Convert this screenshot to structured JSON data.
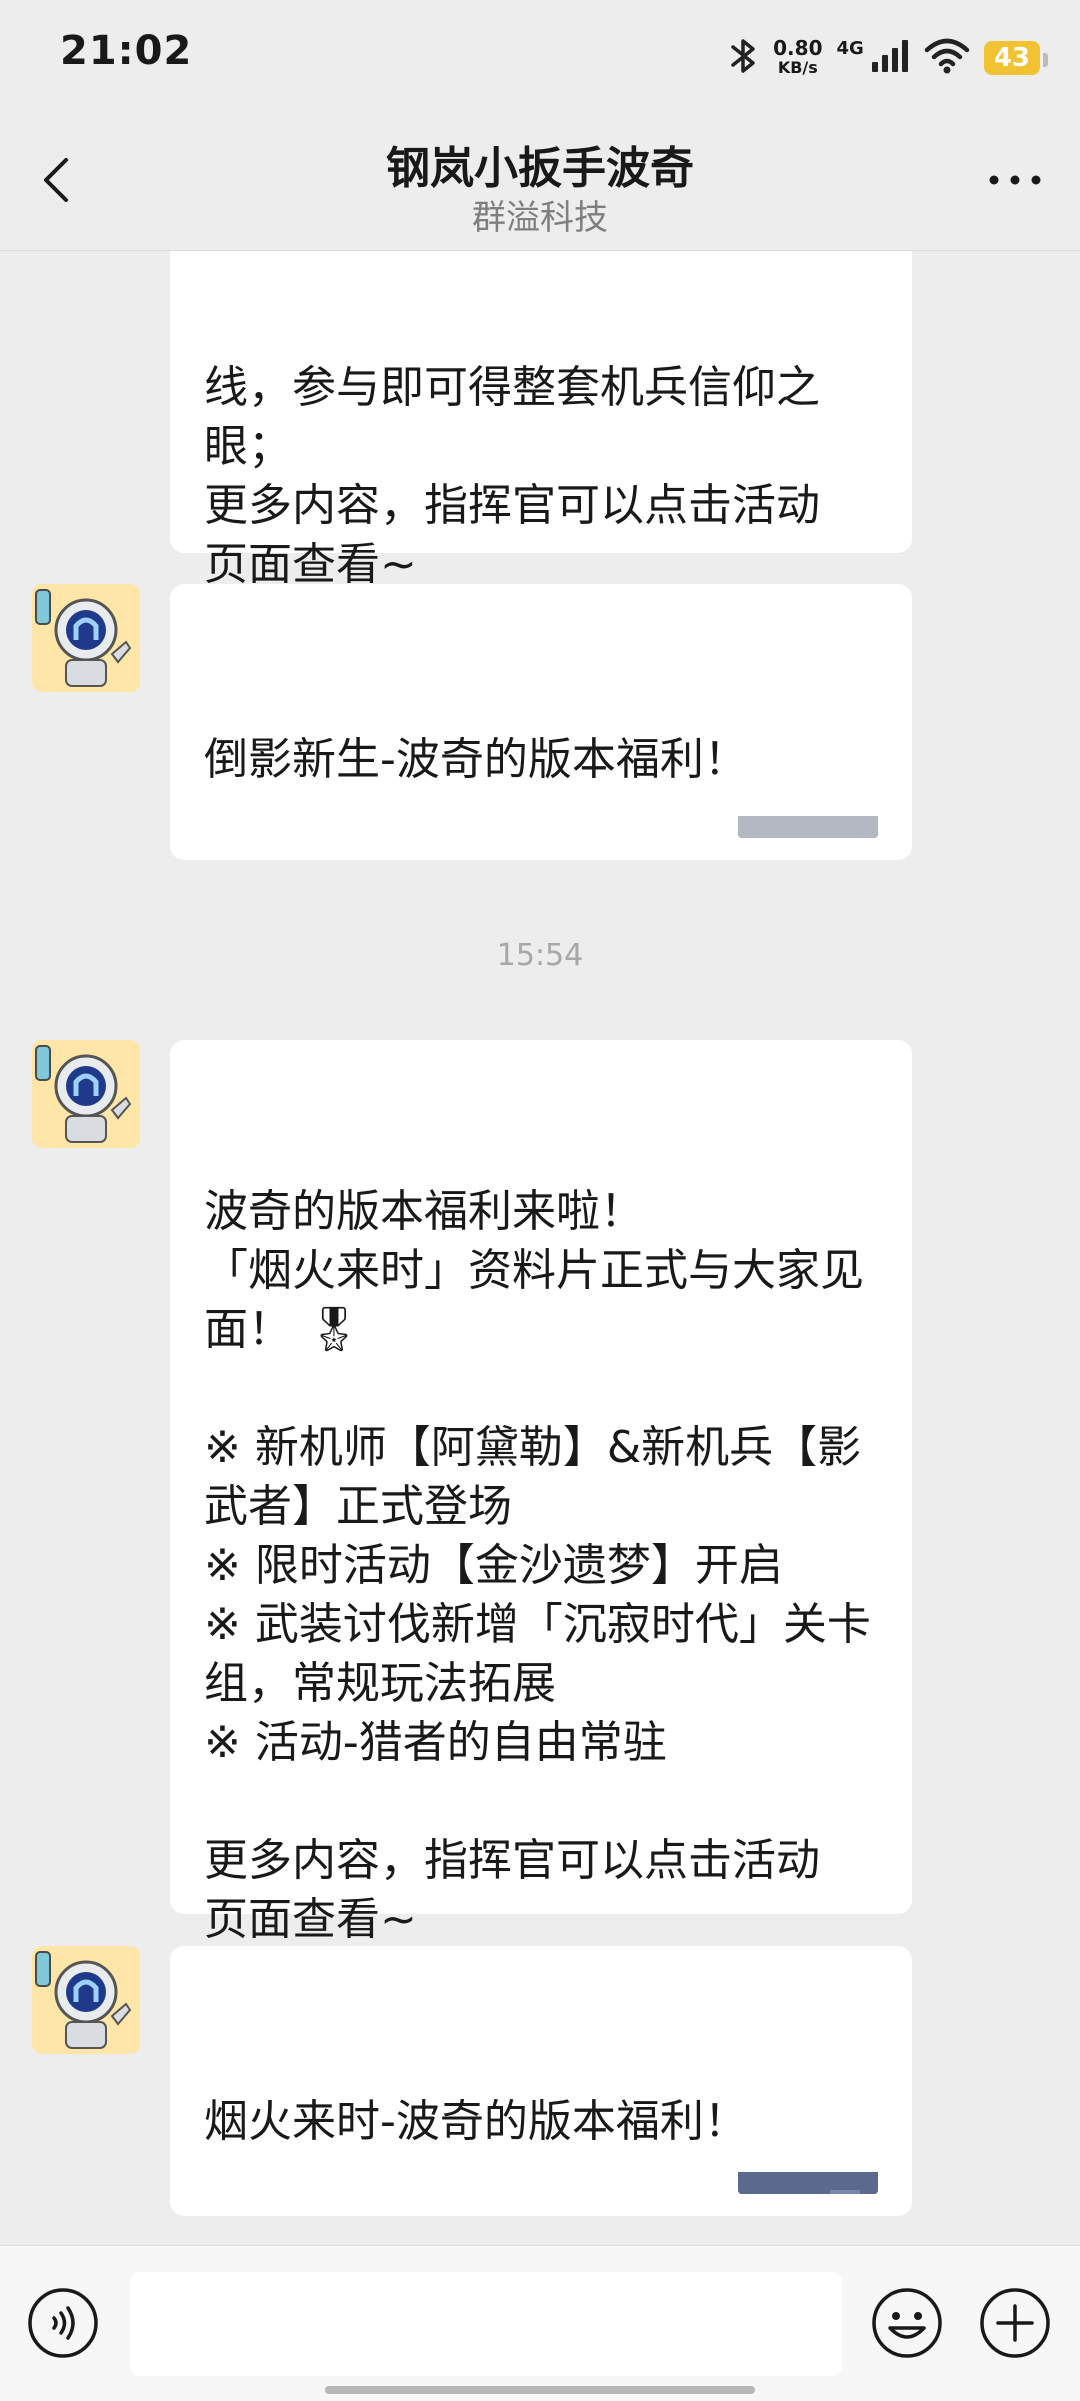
{
  "status_bar": {
    "time": "21:02",
    "net_speed_value": "0.80",
    "net_speed_unit": "KB/s",
    "network": "4G",
    "battery": "43",
    "icons": [
      "bluetooth-icon",
      "signal-icon",
      "wifi-icon",
      "battery-icon"
    ]
  },
  "header": {
    "title": "钢岚小扳手波奇",
    "subtitle": "群溢科技",
    "back_icon": "chevron-left-icon",
    "more_icon": "more-dots-icon"
  },
  "messages": [
    {
      "type": "text",
      "text": "线，参与即可得整套机兵信仰之\n眼；\n更多内容，指挥官可以点击活动\n页面查看~\n🌟 不要忘记最后的福利哦！"
    },
    {
      "type": "link",
      "title": "倒影新生-波奇的版本福利！",
      "thumbnail": "anime-illustration"
    },
    {
      "type": "timestamp",
      "text": "15:54"
    },
    {
      "type": "text",
      "text": "波奇的版本福利来啦！\n「烟火来时」资料片正式与大家见\n面！ 🎖\n\n※ 新机师【阿黛勒】&新机兵【影\n武者】正式登场\n※ 限时活动【金沙遗梦】开启\n※ 武装讨伐新增「沉寂时代」关卡\n组，常规玩法拓展\n※ 活动-猎者的自由常驻\n\n更多内容，指挥官可以点击活动\n页面查看~\n🌟 不要忘记最后的福利哦！"
    },
    {
      "type": "link",
      "title": "烟火来时-波奇的版本福利！",
      "thumbnail": "anime-illustration"
    }
  ],
  "input_bar": {
    "value": "",
    "placeholder": "",
    "voice_icon": "voice-icon",
    "emoji_icon": "emoji-icon",
    "plus_icon": "plus-icon"
  }
}
